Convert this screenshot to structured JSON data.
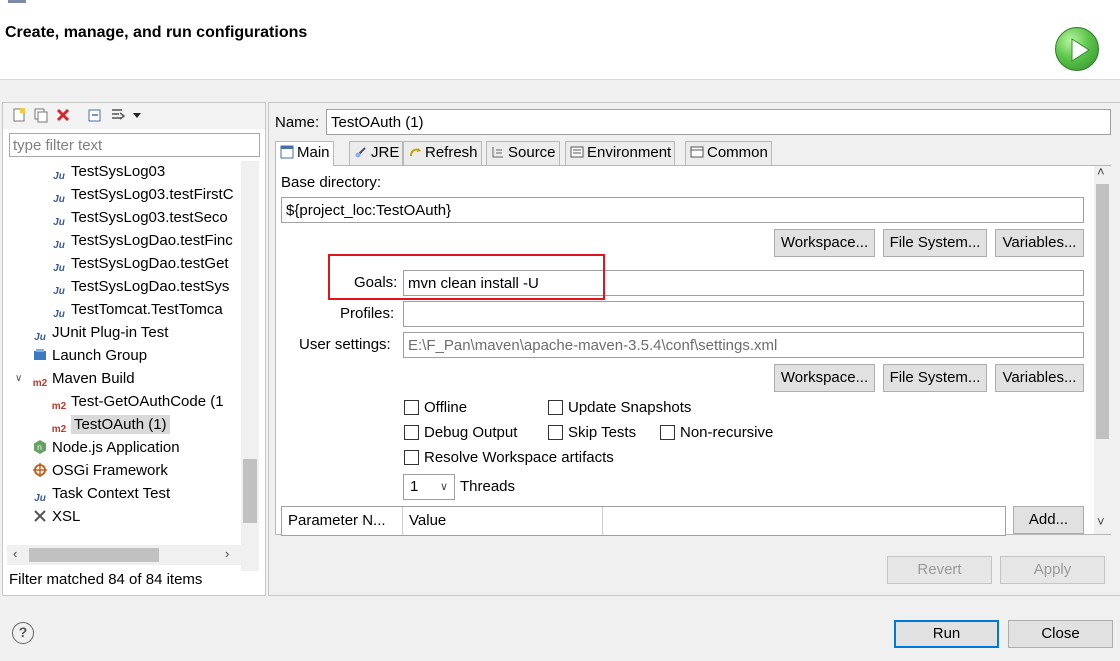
{
  "header": {
    "title": "Create, manage, and run configurations",
    "run_icon": "run-play-icon",
    "accent": "#3fae35"
  },
  "left": {
    "toolbar_icons": [
      "new-config-icon",
      "duplicate-icon",
      "delete-icon",
      "collapse-all-icon",
      "filter-icon",
      "dropdown-arrow-icon"
    ],
    "filter_placeholder": "type filter text",
    "tree": [
      {
        "label": "TestSysLog03",
        "icon": "junit-icon",
        "level": 2
      },
      {
        "label": "TestSysLog03.testFirstC",
        "icon": "junit-icon",
        "level": 2
      },
      {
        "label": "TestSysLog03.testSeco",
        "icon": "junit-icon",
        "level": 2
      },
      {
        "label": "TestSysLogDao.testFinc",
        "icon": "junit-icon",
        "level": 2
      },
      {
        "label": "TestSysLogDao.testGet",
        "icon": "junit-icon",
        "level": 2
      },
      {
        "label": "TestSysLogDao.testSys",
        "icon": "junit-icon",
        "level": 2
      },
      {
        "label": "TestTomcat.TestTomca",
        "icon": "junit-icon",
        "level": 2
      },
      {
        "label": "JUnit Plug-in Test",
        "icon": "junit-plugin-icon",
        "level": 1
      },
      {
        "label": "Launch Group",
        "icon": "launch-group-icon",
        "level": 1
      },
      {
        "label": "Maven Build",
        "icon": "maven-icon",
        "level": 1,
        "expanded": true
      },
      {
        "label": "Test-GetOAuthCode (1",
        "icon": "maven-icon",
        "level": 2
      },
      {
        "label": "TestOAuth (1)",
        "icon": "maven-icon",
        "level": 2,
        "selected": true
      },
      {
        "label": "Node.js Application",
        "icon": "nodejs-icon",
        "level": 1
      },
      {
        "label": "OSGi Framework",
        "icon": "osgi-icon",
        "level": 1
      },
      {
        "label": "Task Context Test",
        "icon": "junit-icon",
        "level": 1
      },
      {
        "label": "XSL",
        "icon": "xsl-icon",
        "level": 1
      }
    ],
    "status": "Filter matched 84 of 84 items"
  },
  "right": {
    "name_label": "Name:",
    "name_value": "TestOAuth (1)",
    "tabs": [
      {
        "label": "Main",
        "icon": "main-tab-icon",
        "active": true
      },
      {
        "label": "JRE",
        "icon": "jre-icon"
      },
      {
        "label": "Refresh",
        "icon": "refresh-icon"
      },
      {
        "label": "Source",
        "icon": "source-icon"
      },
      {
        "label": "Environment",
        "icon": "environment-icon"
      },
      {
        "label": "Common",
        "icon": "common-icon"
      }
    ],
    "base_dir_label": "Base directory:",
    "base_dir_value": "${project_loc:TestOAuth}",
    "workspace_label": "Workspace...",
    "filesystem_label": "File System...",
    "variables_label": "Variables...",
    "goals_label": "Goals:",
    "goals_value": "mvn clean install -U",
    "profiles_label": "Profiles:",
    "profiles_value": "",
    "user_settings_label": "User settings:",
    "user_settings_value": "E:\\F_Pan\\maven\\apache-maven-3.5.4\\conf\\settings.xml",
    "checkboxes": {
      "offline": "Offline",
      "update_snapshots": "Update Snapshots",
      "debug_output": "Debug Output",
      "skip_tests": "Skip Tests",
      "non_recursive": "Non-recursive",
      "resolve_workspace": "Resolve Workspace artifacts"
    },
    "threads_value": "1",
    "threads_label": "Threads",
    "param_col_name": "Parameter N...",
    "param_col_value": "Value",
    "add_label": "Add...",
    "revert_label": "Revert",
    "apply_label": "Apply"
  },
  "footer": {
    "help_icon": "help-icon",
    "help_glyph": "?",
    "run_label": "Run",
    "close_label": "Close"
  },
  "colors": {
    "highlight": "#e0141e",
    "default_button_border": "#0078d7"
  }
}
